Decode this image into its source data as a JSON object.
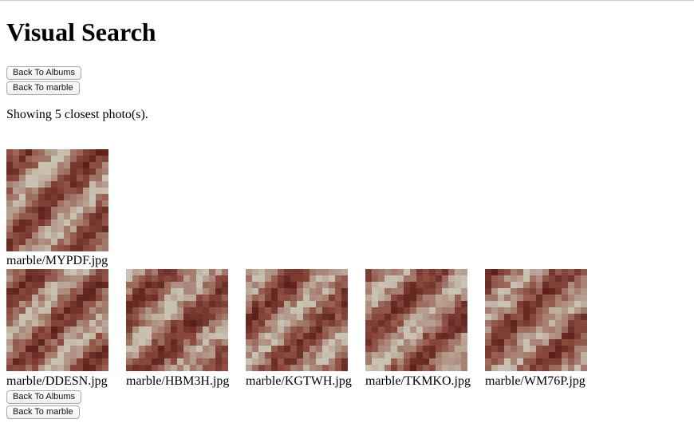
{
  "header": {
    "title": "Visual Search"
  },
  "nav": {
    "back_to_albums": "Back To Albums",
    "back_to_album": "Back To marble"
  },
  "status_text": "Showing 5 closest photo(s).",
  "query_photo": {
    "caption": "marble/MYPDF.jpg"
  },
  "results": [
    {
      "caption": "marble/DDESN.jpg"
    },
    {
      "caption": "marble/HBM3H.jpg"
    },
    {
      "caption": "marble/KGTWH.jpg"
    },
    {
      "caption": "marble/TKMKO.jpg"
    },
    {
      "caption": "marble/WM76P.jpg"
    }
  ],
  "colors": {
    "texture_dark": "#5a1f1a",
    "texture_mid": "#8a4a3e",
    "texture_light": "#c9c2b2"
  }
}
